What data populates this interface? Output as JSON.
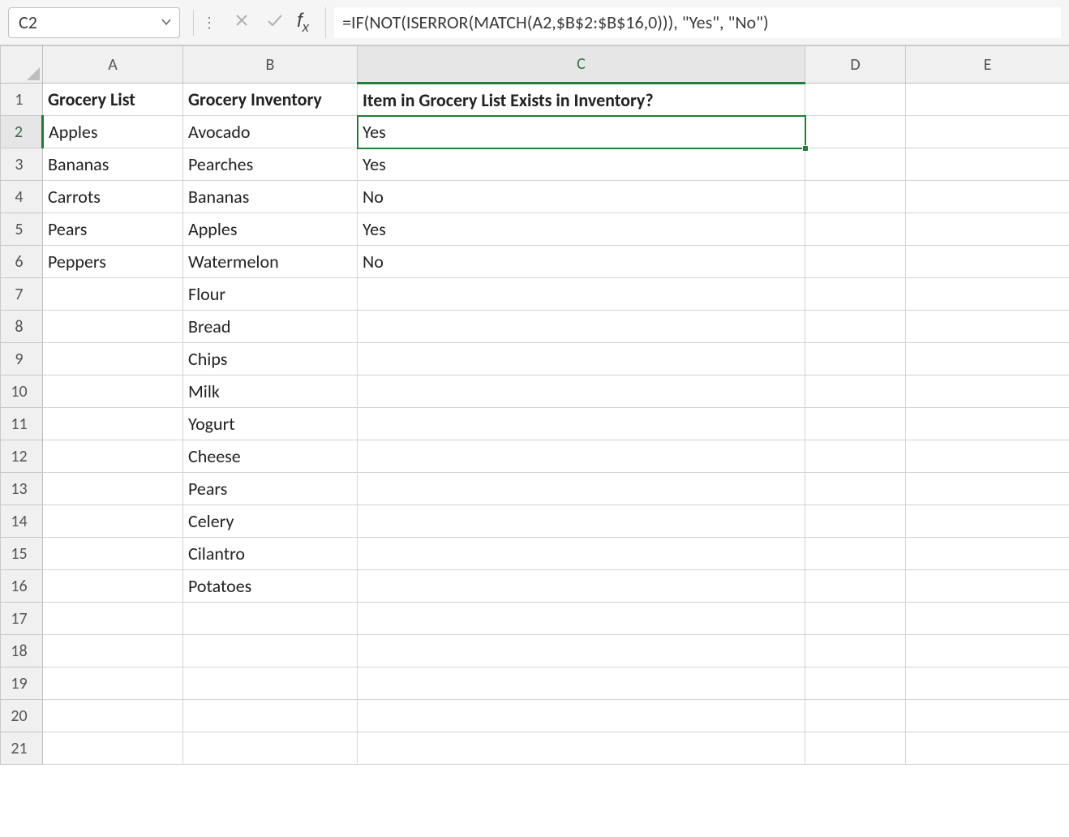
{
  "formula_bar": {
    "name_box": "C2",
    "formula": "=IF(NOT(ISERROR(MATCH(A2,$B$2:$B$16,0))), \"Yes\", \"No\")"
  },
  "columns": [
    "A",
    "B",
    "C",
    "D",
    "E"
  ],
  "row_numbers": [
    "1",
    "2",
    "3",
    "4",
    "5",
    "6",
    "7",
    "8",
    "9",
    "10",
    "11",
    "12",
    "13",
    "14",
    "15",
    "16",
    "17",
    "18",
    "19",
    "20",
    "21"
  ],
  "active_cell": "C2",
  "headers": {
    "A": "Grocery List",
    "B": "Grocery Inventory",
    "C": "Item in Grocery List Exists in Inventory?"
  },
  "data": {
    "A": [
      "Apples",
      "Bananas",
      "Carrots",
      "Pears",
      "Peppers",
      "",
      "",
      "",
      "",
      "",
      "",
      "",
      "",
      "",
      ""
    ],
    "B": [
      "Avocado",
      "Pearches",
      "Bananas",
      "Apples",
      "Watermelon",
      "Flour",
      "Bread",
      "Chips",
      "Milk",
      "Yogurt",
      "Cheese",
      "Pears",
      "Celery",
      "Cilantro",
      "Potatoes"
    ],
    "C": [
      "Yes",
      "Yes",
      "No",
      "Yes",
      "No",
      "",
      "",
      "",
      "",
      "",
      "",
      "",
      "",
      "",
      ""
    ]
  }
}
